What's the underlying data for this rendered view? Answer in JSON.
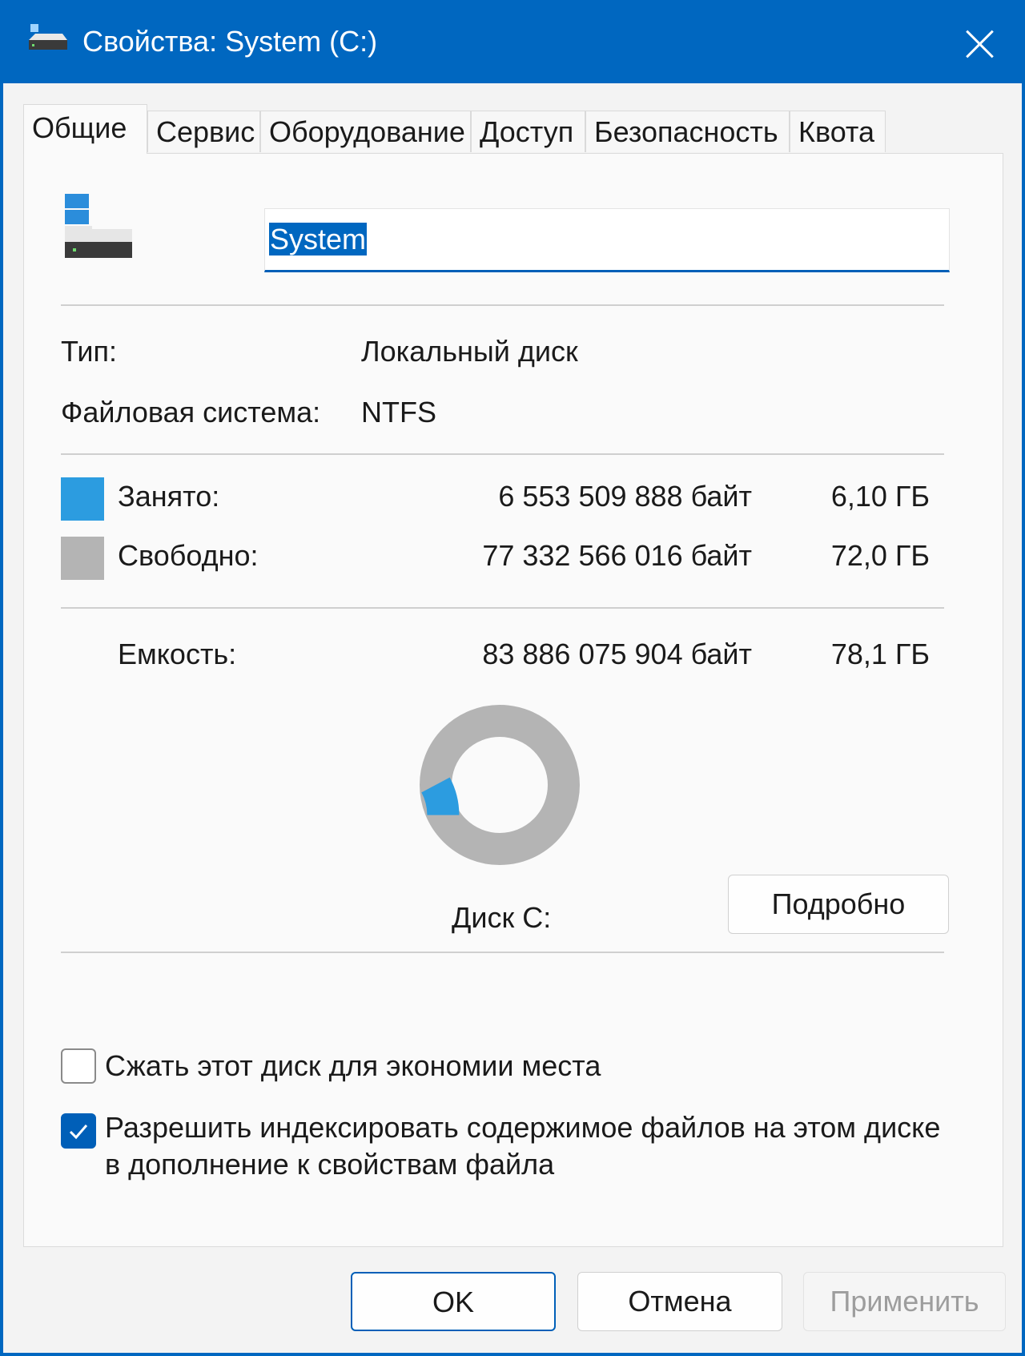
{
  "window": {
    "title": "Свойства: System (C:)",
    "accent_color": "#0067c0"
  },
  "tabs": [
    {
      "label": "Общие",
      "active": true
    },
    {
      "label": "Сервис",
      "active": false
    },
    {
      "label": "Оборудование",
      "active": false
    },
    {
      "label": "Доступ",
      "active": false
    },
    {
      "label": "Безопасность",
      "active": false
    },
    {
      "label": "Квота",
      "active": false
    }
  ],
  "drive": {
    "name_value": "System",
    "icon": "hard-drive-icon"
  },
  "info": {
    "type_label": "Тип:",
    "type_value": "Локальный диск",
    "fs_label": "Файловая система:",
    "fs_value": "NTFS"
  },
  "usage": {
    "used_label": "Занято:",
    "used_bytes": "6 553 509 888 байт",
    "used_size": "6,10 ГБ",
    "used_color": "#2c9ce0",
    "free_label": "Свободно:",
    "free_bytes": "77 332 566 016 байт",
    "free_size": "72,0 ГБ",
    "free_color": "#b4b4b4",
    "capacity_label": "Емкость:",
    "capacity_bytes": "83 886 075 904 байт",
    "capacity_size": "78,1 ГБ",
    "used_fraction": 0.078
  },
  "disk_caption": "Диск C:",
  "details_button": "Подробно",
  "options": {
    "compress_label": "Сжать этот диск для экономии места",
    "compress_checked": false,
    "index_label": "Разрешить индексировать содержимое файлов на этом диске в дополнение к свойствам файла",
    "index_checked": true
  },
  "buttons": {
    "ok": "OK",
    "cancel": "Отмена",
    "apply": "Применить"
  }
}
